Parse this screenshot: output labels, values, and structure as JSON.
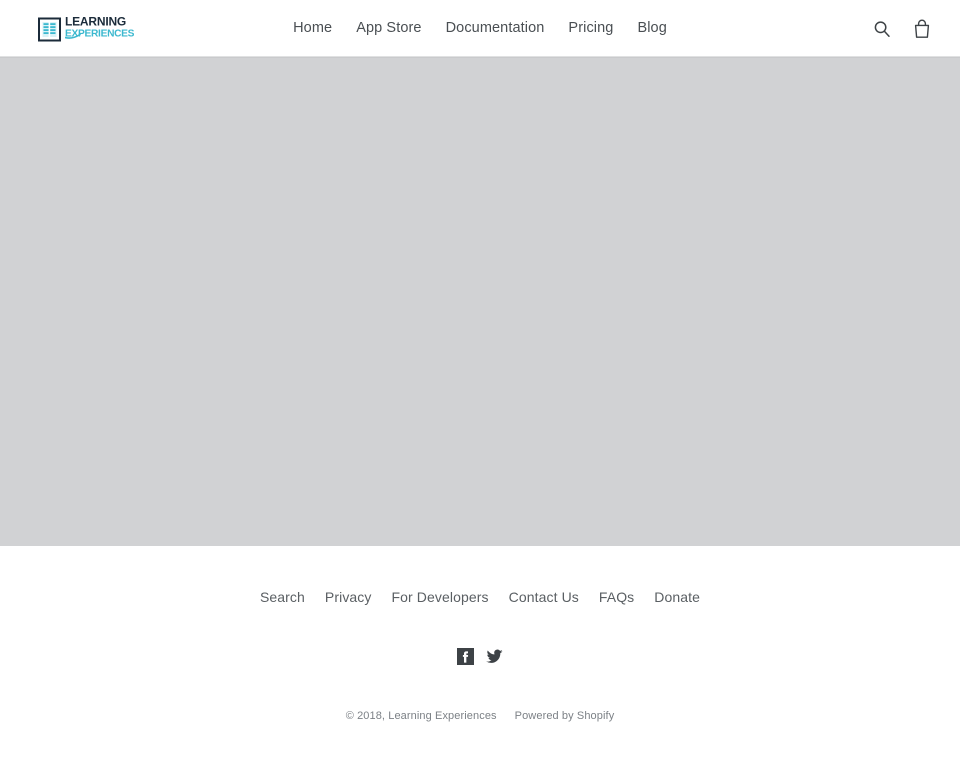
{
  "header": {
    "logo": {
      "icon_name": "book-document-icon",
      "line1": "LEARNING",
      "line2": "EXPERIENCES",
      "dark_color": "#1b2b3a",
      "accent_color": "#3bb8cf"
    },
    "nav": [
      {
        "label": "Home"
      },
      {
        "label": "App Store"
      },
      {
        "label": "Documentation"
      },
      {
        "label": "Pricing"
      },
      {
        "label": "Blog"
      }
    ],
    "icons": [
      {
        "name": "search-icon",
        "label": "Search"
      },
      {
        "name": "shopping-bag-icon",
        "label": "Cart"
      }
    ]
  },
  "main": {
    "placeholder_color": "#d1d2d4"
  },
  "footer": {
    "links": [
      {
        "label": "Search"
      },
      {
        "label": "Privacy"
      },
      {
        "label": "For Developers"
      },
      {
        "label": "Contact Us"
      },
      {
        "label": "FAQs"
      },
      {
        "label": "Donate"
      }
    ],
    "social": [
      {
        "name": "facebook-icon",
        "label": "Facebook"
      },
      {
        "name": "twitter-icon",
        "label": "Twitter"
      }
    ],
    "copyright": "© 2018, Learning Experiences",
    "powered_by": "Powered by Shopify"
  }
}
